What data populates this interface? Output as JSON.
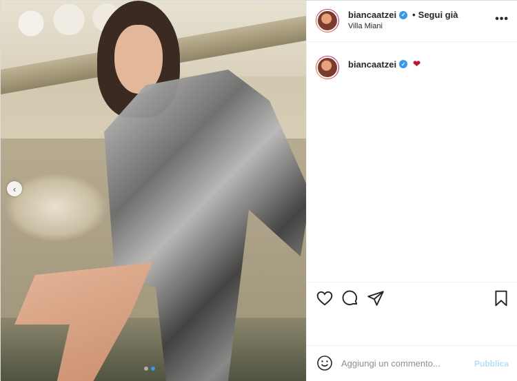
{
  "post": {
    "username": "biancaatzei",
    "follow_label": "Segui già",
    "separator": "•",
    "location": "Villa Miani",
    "more_label": "•••"
  },
  "caption": {
    "username": "biancaatzei",
    "emoji": "❤"
  },
  "carousel": {
    "prev_label": "‹",
    "dots": 2,
    "active_index": 1
  },
  "actions": {
    "icons": [
      "heart-icon",
      "comment-icon",
      "share-icon",
      "bookmark-icon"
    ]
  },
  "add_comment": {
    "placeholder": "Aggiungi un commento...",
    "publish_label": "Pubblica"
  },
  "colors": {
    "verified": "#3897f0",
    "publish_disabled": "#b2dffc",
    "border": "#efefef"
  }
}
